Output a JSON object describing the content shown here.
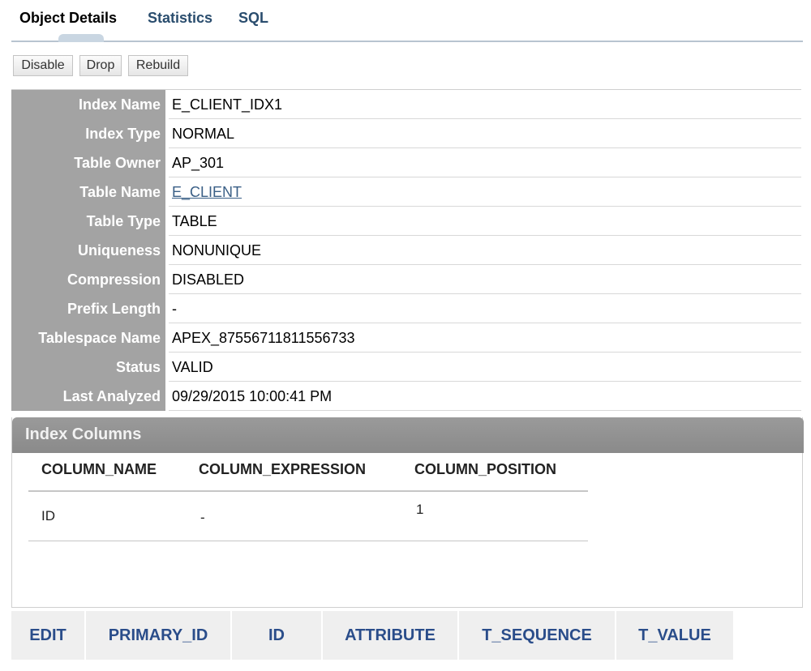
{
  "tabs": {
    "object_details": "Object Details",
    "statistics": "Statistics",
    "sql": "SQL"
  },
  "toolbar": {
    "disable": "Disable",
    "drop": "Drop",
    "rebuild": "Rebuild"
  },
  "details": [
    {
      "label": "Index Name",
      "value": "E_CLIENT_IDX1"
    },
    {
      "label": "Index Type",
      "value": "NORMAL"
    },
    {
      "label": "Table Owner",
      "value": "AP_301"
    },
    {
      "label": "Table Name",
      "value": "E_CLIENT",
      "link": true
    },
    {
      "label": "Table Type",
      "value": "TABLE"
    },
    {
      "label": "Uniqueness",
      "value": "NONUNIQUE"
    },
    {
      "label": "Compression",
      "value": "DISABLED"
    },
    {
      "label": "Prefix Length",
      "value": "-"
    },
    {
      "label": "Tablespace Name",
      "value": "APEX_87556711811556733"
    },
    {
      "label": "Status",
      "value": "VALID"
    },
    {
      "label": "Last Analyzed",
      "value": "09/29/2015 10:00:41 PM"
    }
  ],
  "index_columns": {
    "title": "Index Columns",
    "headers": [
      "COLUMN_NAME",
      "COLUMN_EXPRESSION",
      "COLUMN_POSITION"
    ],
    "rows": [
      [
        "ID",
        "-",
        "1"
      ]
    ]
  },
  "bottom_headers": [
    "EDIT",
    "PRIMARY_ID",
    "ID",
    "ATTRIBUTE",
    "T_SEQUENCE",
    "T_VALUE"
  ]
}
